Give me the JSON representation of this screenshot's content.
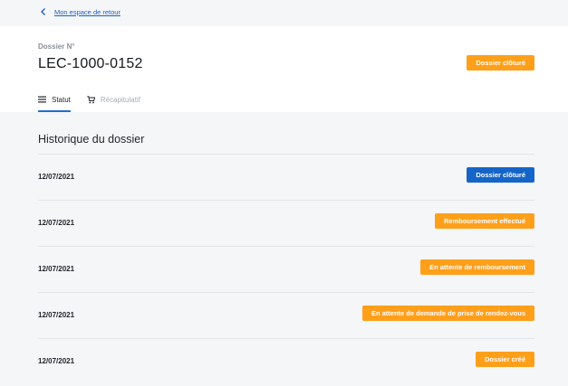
{
  "topbar": {
    "back_label": "Mon espace de retour"
  },
  "header": {
    "dossier_label": "Dossier N°",
    "dossier_number": "LEC-1000-0152",
    "status": "Dossier clôturé",
    "status_color": "#ff9f1a"
  },
  "tabs": [
    {
      "label": "Statut",
      "icon": "menu-icon",
      "active": true
    },
    {
      "label": "Récapitulatif",
      "icon": "cart-icon",
      "active": false
    }
  ],
  "history": {
    "title": "Historique du dossier",
    "rows": [
      {
        "date": "12/07/2021",
        "status": "Dossier clôturé",
        "color": "#1565c8"
      },
      {
        "date": "12/07/2021",
        "status": "Remboursement effectué",
        "color": "#ff9f1a"
      },
      {
        "date": "12/07/2021",
        "status": "En attente de remboursement",
        "color": "#ff9f1a"
      },
      {
        "date": "12/07/2021",
        "status": "En attente de demande de prise de rendez-vous",
        "color": "#ff9f1a"
      },
      {
        "date": "12/07/2021",
        "status": "Dossier créé",
        "color": "#ff9f1a"
      }
    ]
  }
}
